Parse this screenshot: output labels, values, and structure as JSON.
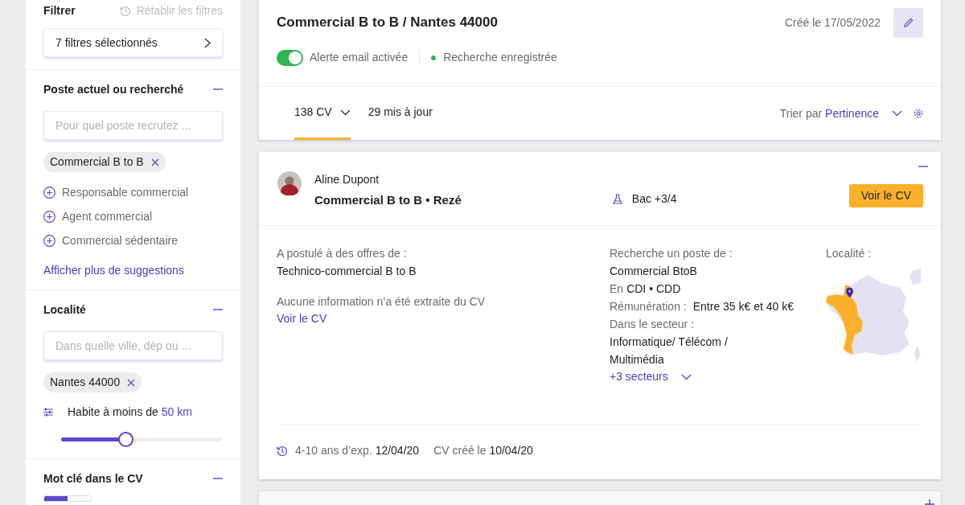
{
  "sidebar": {
    "title": "Filtrer",
    "reset_link": "Rétablir les filtres",
    "filters_button": "7 filtres sélectionnés",
    "sections": [
      {
        "kind": "job",
        "title": "Poste actuel ou recherché",
        "expanded": true,
        "placeholder": "Pour quel poste recrutez ...",
        "chips": [
          "Commercial B to B"
        ],
        "suggestions": [
          "Responsable commercial",
          "Agent commercial",
          "Commercial sédentaire"
        ],
        "more_link": "Afficher plus de suggestions"
      },
      {
        "kind": "location",
        "title": "Localité",
        "expanded": true,
        "placeholder": "Dans quelle ville, dép ou ...",
        "chips": [
          "Nantes 44000"
        ],
        "radius": {
          "label": "Habite à moins de",
          "value": "50 km",
          "level": 0.4
        }
      },
      {
        "kind": "keyword",
        "title": "Mot clé dans le CV",
        "expanded": true
      }
    ]
  },
  "search": {
    "title": "Commercial B to B / Nantes 44000",
    "created": "Créé le 17/05/2022",
    "email_alert": {
      "label": "Alerte email activée",
      "on": true
    },
    "saved_status": "Recherche enregistrée"
  },
  "results_tabs": [
    {
      "label": "138 CV",
      "selected": true,
      "dropdown": true
    },
    {
      "label": "29 mis à jour",
      "selected": false,
      "dropdown": false
    }
  ],
  "sort": {
    "label": "Trier par",
    "value": "Pertinence"
  },
  "candidate": {
    "expanded": true,
    "name": "Aline Dupont",
    "headline": "Commercial B to B • Rezé",
    "education": "Bac +3/4",
    "button": "Voir le CV",
    "applied_label": "A postulé à des offres de :",
    "applied_value": "Technico-commercial B to B",
    "no_info": "Aucune information n’a été extraite du CV",
    "link": "Voir le CV",
    "seeking_label": "Recherche un poste de :",
    "seeking_value": "Commercial BtoB",
    "contract_label": "En",
    "contract_value": "CDI • CDD",
    "salary_label": "Rémunération :",
    "salary_value": "Entre 35 k€ et 40 k€",
    "sector_label": "Dans le secteur :",
    "sector_value": "Informatique/ Télécom / Multimédia",
    "more_sectors": "+3 secteurs",
    "location_label": "Localité :",
    "experience": "4-10 ans d’exp.",
    "experience_date": "12/04/20",
    "created_label": "CV créé le",
    "created_date": "10/04/20"
  },
  "next_candidate": {
    "expanded": false
  }
}
